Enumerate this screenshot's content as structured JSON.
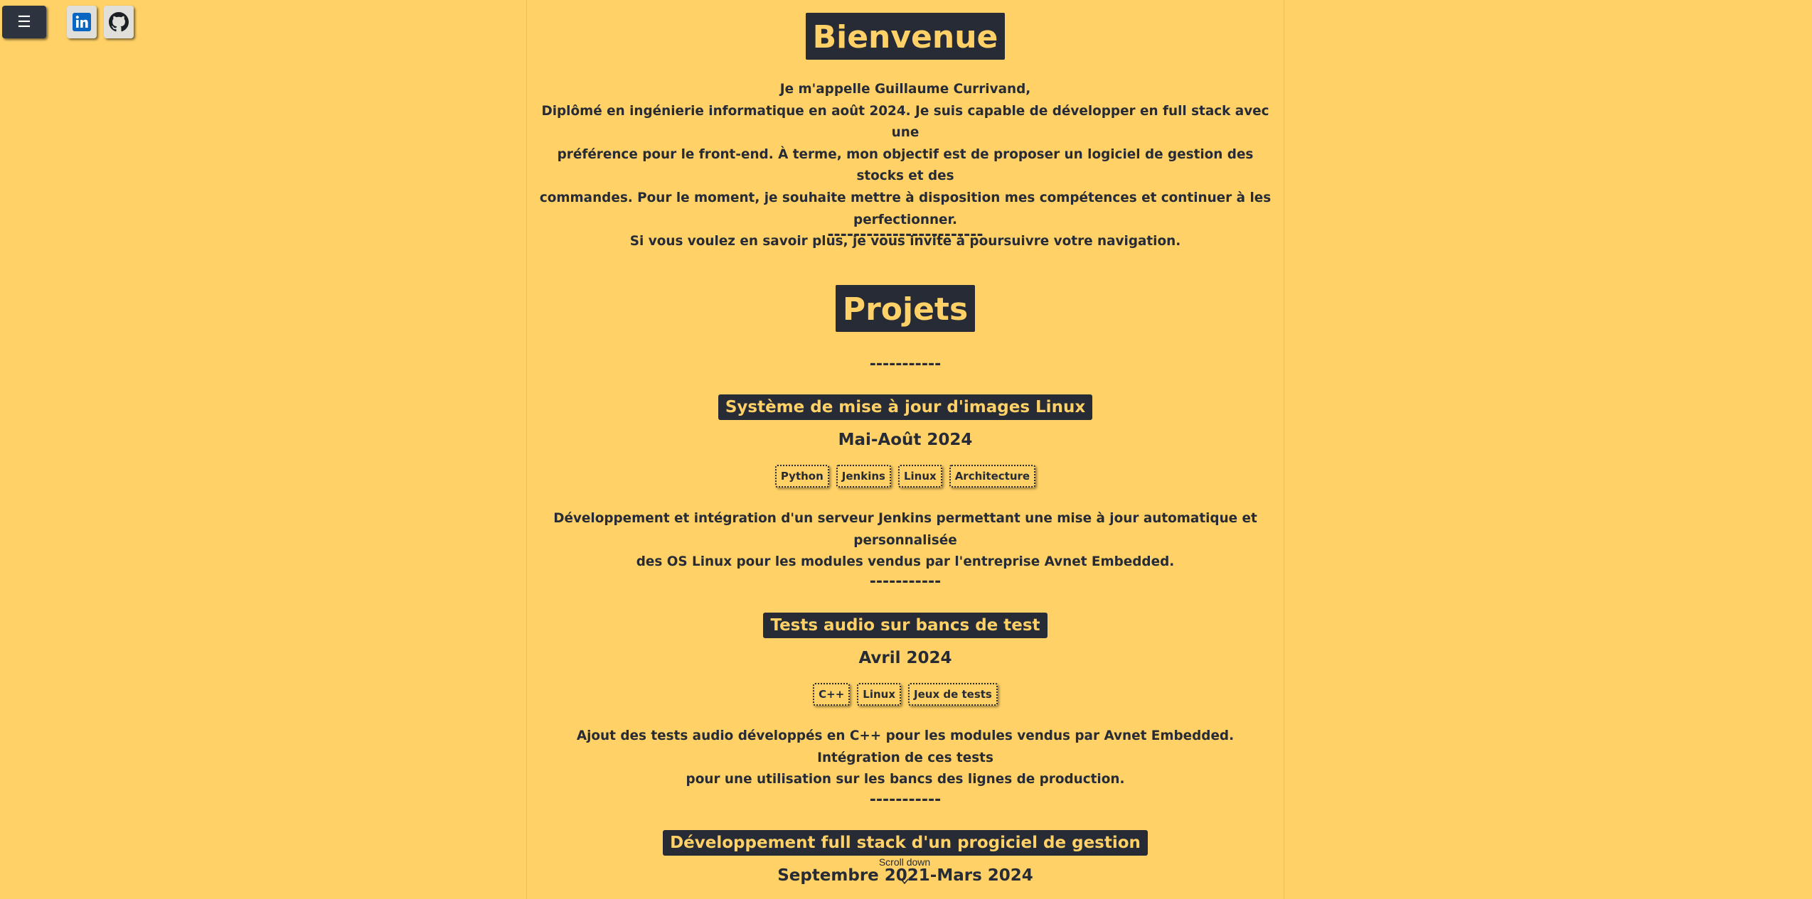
{
  "header": {
    "menu_label": "☰",
    "social": [
      {
        "name": "linkedin-icon"
      },
      {
        "name": "github-icon"
      }
    ]
  },
  "welcome": {
    "title": "Bienvenue",
    "lines": [
      "Je m'appelle Guillaume Currivand,",
      "Diplômé en ingénierie informatique en août 2024. Je suis capable de développer en full stack avec une",
      "préférence pour le front-end. À terme, mon objectif est de proposer un logiciel de gestion des stocks et des",
      "commandes. Pour le moment, je souhaite mettre à disposition mes compétences et continuer à les perfectionner.",
      "Si vous voulez en savoir plus, je vous invite à poursuivre votre navigation."
    ]
  },
  "separator_long": "------------------------",
  "separator_short": "-----------",
  "projects": {
    "title": "Projets",
    "items": [
      {
        "title": "Système de mise à jour d'images Linux",
        "date": "Mai-Août 2024",
        "tags": [
          "Python",
          "Jenkins",
          "Linux",
          "Architecture"
        ],
        "desc_lines": [
          "Développement et intégration d'un serveur Jenkins permettant une mise à jour automatique et personnalisée",
          "des OS Linux pour les modules vendus par l'entreprise Avnet Embedded."
        ]
      },
      {
        "title": "Tests audio sur bancs de test",
        "date": "Avril 2024",
        "tags": [
          "C++",
          "Linux",
          "Jeux de tests"
        ],
        "desc_lines": [
          "Ajout des tests audio développés en C++ pour les modules vendus par Avnet Embedded. Intégration de ces tests",
          "pour une utilisation sur les bancs des lignes de production."
        ]
      },
      {
        "title": "Développement full stack d'un progiciel de gestion",
        "date": "Septembre 2021-Mars 2024"
      }
    ]
  },
  "scroll_hint": "Scroll down",
  "colors": {
    "background": "#ffd166",
    "dark": "#262b36",
    "accent_text": "#ffd166"
  }
}
